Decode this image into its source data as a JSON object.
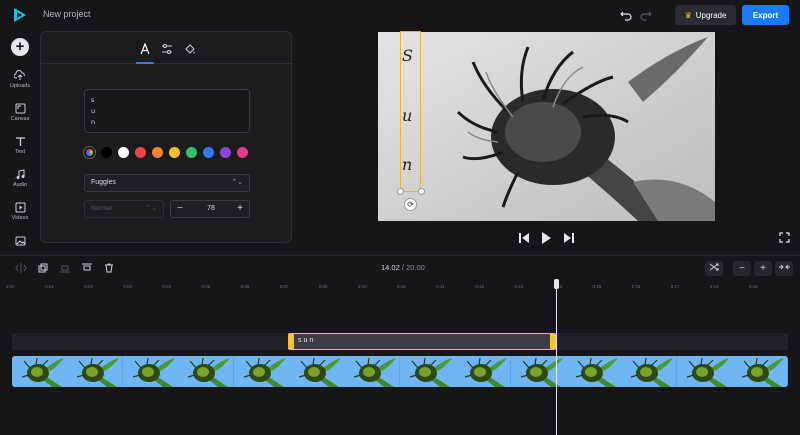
{
  "header": {
    "project_name": "New project",
    "upgrade_label": "Upgrade",
    "export_label": "Export",
    "export_color": "#1a7cf5"
  },
  "sidebar": {
    "items": [
      {
        "label": "Uploads",
        "icon": "upload-icon"
      },
      {
        "label": "Canvas",
        "icon": "canvas-icon"
      },
      {
        "label": "Text",
        "icon": "text-icon"
      },
      {
        "label": "Audio",
        "icon": "music-icon"
      },
      {
        "label": "Videos",
        "icon": "video-icon"
      },
      {
        "label": "",
        "icon": "image-icon"
      }
    ]
  },
  "text_panel": {
    "tabs": [
      "text-style-icon",
      "adjust-sliders-icon",
      "fill-bucket-icon"
    ],
    "active_tab": 0,
    "text_value": "s\nu\nn",
    "colors": [
      "#000000",
      "#ffffff",
      "#e84545",
      "#f2853a",
      "#f6c02a",
      "#34c06a",
      "#2f7bf3",
      "#8e44d6",
      "#e63c88"
    ],
    "font_family": "Fuggles",
    "font_weight": "Normal",
    "font_size": "78"
  },
  "preview": {
    "overlay_letters": [
      "S",
      "u",
      "n"
    ]
  },
  "timeline": {
    "current_time": "14.02",
    "separator": "/",
    "total_time": "20.00",
    "ruler_ticks": [
      "0:00",
      "0:01",
      "0:02",
      "0:03",
      "0:04",
      "0:05",
      "0:06",
      "0:07",
      "0:08",
      "0:09",
      "0:10",
      "0:11",
      "0:12",
      "0:13",
      "0:14",
      "0:15",
      "0:16",
      "0:17",
      "0:18",
      "0:19"
    ],
    "text_clip_label": "sun",
    "video_thumbnail_count": 14
  }
}
